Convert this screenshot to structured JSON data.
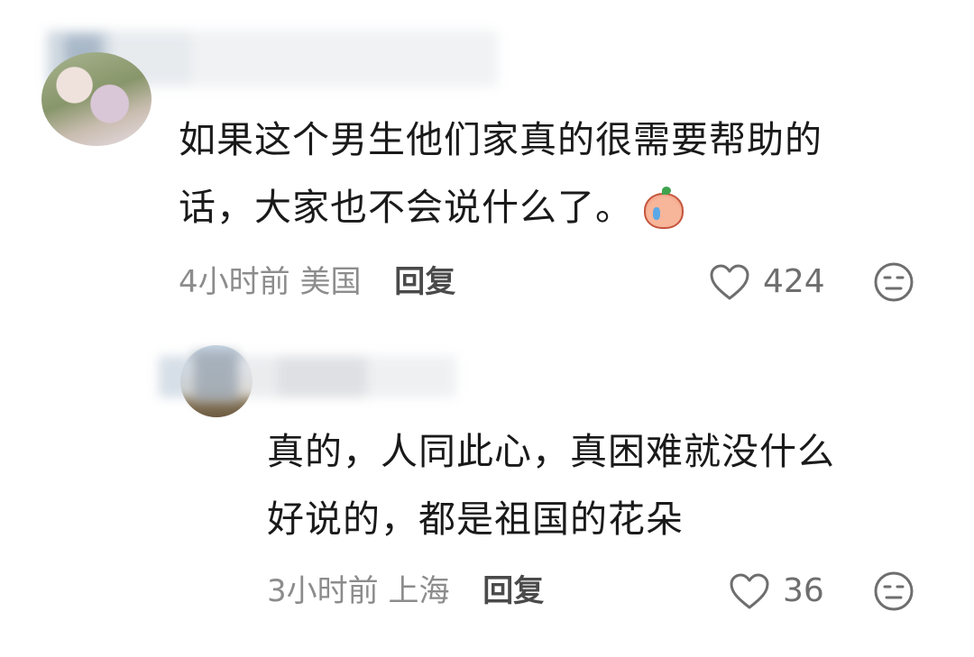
{
  "comments": [
    {
      "text_line1": "如果这个男生他们家真的很需要帮助的",
      "text_line2": "话，大家也不会说什么了。",
      "emoji": "crying-peach-emoji",
      "time": "4小时前",
      "location": "美国",
      "reply_label": "回复",
      "likes": "424",
      "is_reply": false
    },
    {
      "text_line1": "真的，人同此心，真困难就没什么",
      "text_line2": "好说的，都是祖国的花朵",
      "time": "3小时前",
      "location": "上海",
      "reply_label": "回复",
      "likes": "36",
      "is_reply": true
    }
  ],
  "icons": {
    "like": "heart-outline-icon",
    "dislike": "unhappy-face-icon"
  },
  "colors": {
    "text": "#1a1a1a",
    "meta": "#8c8c8c",
    "reply": "#4a4a4a",
    "icon": "#6e6e6e"
  }
}
